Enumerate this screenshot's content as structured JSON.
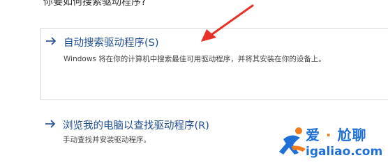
{
  "dialog": {
    "heading": "你要如何搜索驱动程序?",
    "options": [
      {
        "title": "自动搜索驱动程序(S)",
        "description": "Windows 将在你的计算机中搜索最佳可用驱动程序，并将其安装在你的设备上。"
      },
      {
        "title": "浏览我的电脑以查找驱动程序(R)",
        "description": "手动查找并安装驱动程序。"
      }
    ]
  },
  "watermark": {
    "top_left": "爱",
    "separator": "·",
    "top_right": "尬聊",
    "bottom": "igaliao.com"
  },
  "colors": {
    "link": "#1f4c8f",
    "annotation_arrow": "#e8302a",
    "watermark_blue": "#1e6fd6",
    "watermark_orange": "#f07c1b"
  },
  "icons": {
    "option_arrow": "arrow-right-icon",
    "annotation": "red-pointer-arrow",
    "watermark_figure": "running-person-logo"
  }
}
